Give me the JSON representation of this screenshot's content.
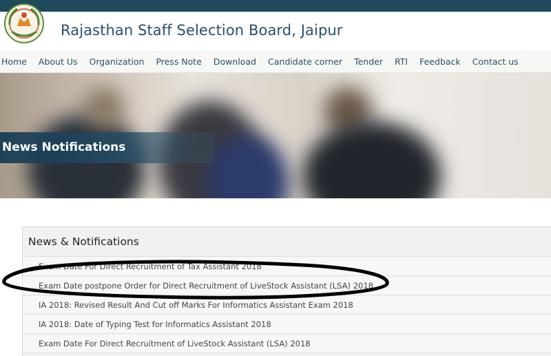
{
  "header": {
    "title": "Rajasthan Staff Selection Board, Jaipur",
    "logo_icon": "emblem-icon",
    "topbar_color": "#1f4a5c"
  },
  "nav": {
    "items": [
      "Home",
      "About Us",
      "Organization",
      "Press Note",
      "Download",
      "Candidate corner",
      "Tender",
      "RTI",
      "Feedback",
      "Contact us"
    ]
  },
  "banner": {
    "title": "News Notifications"
  },
  "news": {
    "heading": "News & Notifications",
    "items": [
      "Exam Date For Direct Recruitment of Tax Assistant 2018",
      "Exam Date postpone Order for Direct Recruitment of LiveStock Assistant (LSA) 2018",
      "IA 2018: Revised Result And Cut off Marks For Informatics Assistant Exam 2018",
      "IA 2018: Date of Typing Test for Informatics Assistant 2018",
      "Exam Date For Direct Recruitment of LiveStock Assistant (LSA) 2018"
    ]
  },
  "annotation": {
    "shape": "hand-drawn-ellipse",
    "color": "#000000"
  }
}
